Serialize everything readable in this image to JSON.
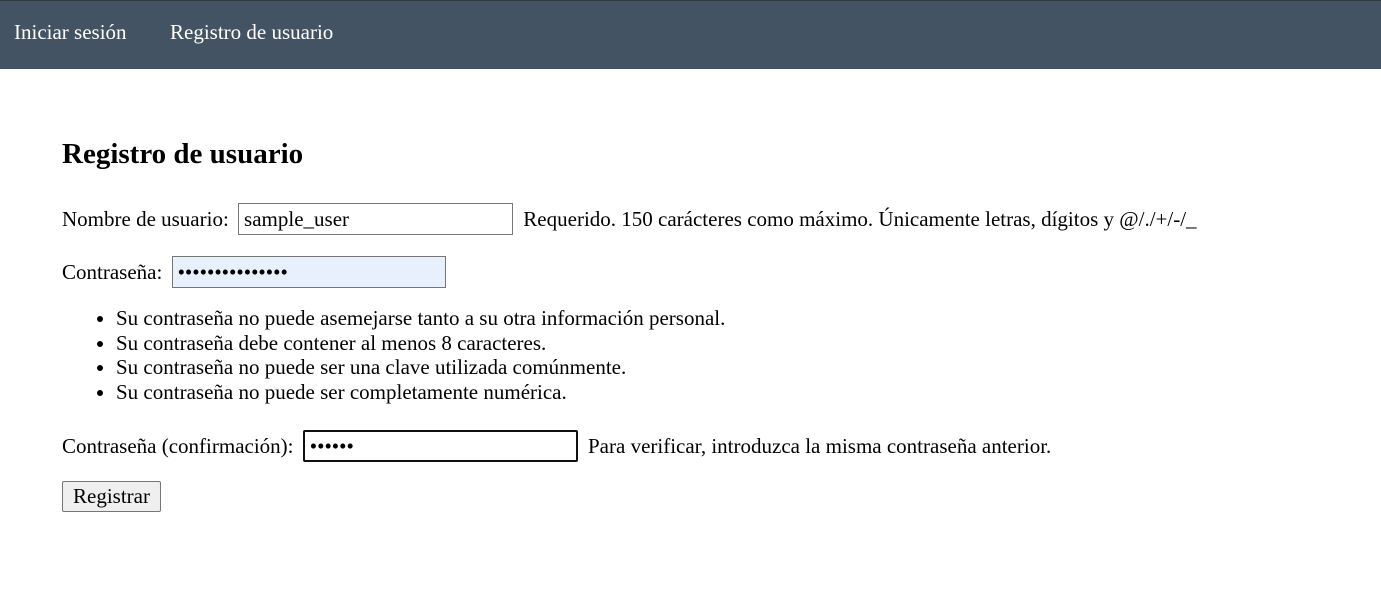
{
  "nav": {
    "login": "Iniciar sesión",
    "register": "Registro de usuario"
  },
  "form": {
    "title": "Registro de usuario",
    "username": {
      "label": "Nombre de usuario:",
      "value": "sample_user",
      "help": "Requerido. 150 carácteres como máximo. Únicamente letras, dígitos y @/./+/-/_"
    },
    "password": {
      "label": "Contraseña:",
      "value": "•••••••••••••••"
    },
    "password_rules": [
      "Su contraseña no puede asemejarse tanto a su otra información personal.",
      "Su contraseña debe contener al menos 8 caracteres.",
      "Su contraseña no puede ser una clave utilizada comúnmente.",
      "Su contraseña no puede ser completamente numérica."
    ],
    "confirm": {
      "label": "Contraseña (confirmación):",
      "value": "••••••",
      "help": "Para verificar, introduzca la misma contraseña anterior."
    },
    "submit": "Registrar"
  }
}
